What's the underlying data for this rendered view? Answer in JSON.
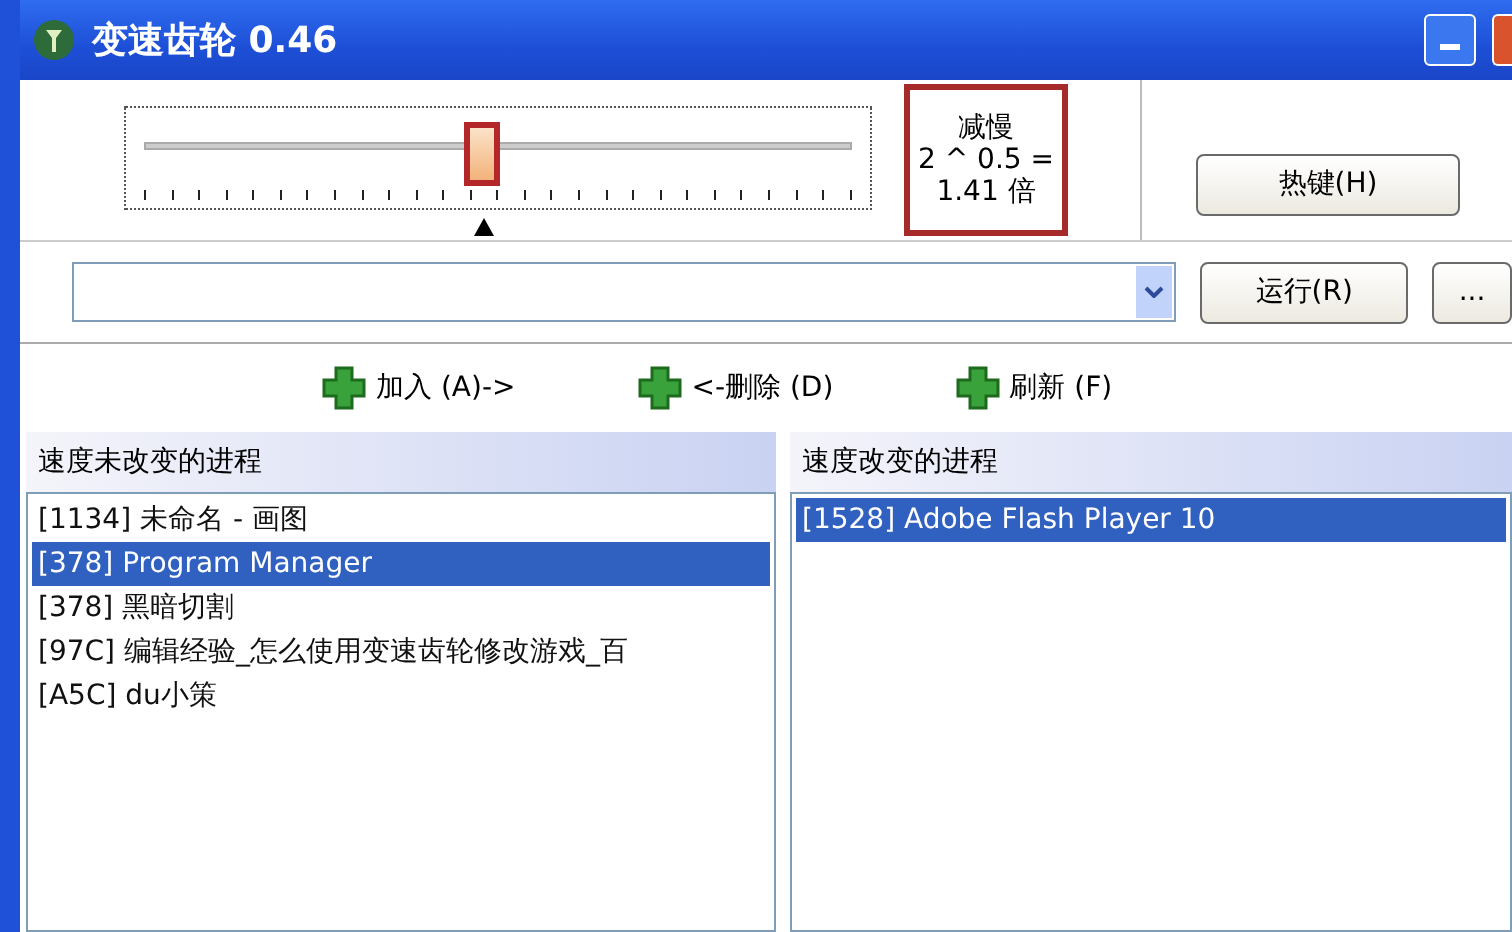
{
  "window": {
    "title": "变速齿轮 0.46"
  },
  "speed": {
    "level": 0.47,
    "readout": [
      "减慢",
      "2 ^ 0.5 =",
      "1.41 倍"
    ]
  },
  "hotkey_button": "热键(H)",
  "run_button": "运行(R)",
  "more_button": "...",
  "actions": [
    {
      "label": "加入 (A)->"
    },
    {
      "label": "<-删除 (D)"
    },
    {
      "label": "刷新 (F)"
    }
  ],
  "panels": [
    {
      "header": "速度未改变的进程",
      "items": [
        {
          "text": "[1134]  未命名 - 画图",
          "selected": false
        },
        {
          "text": "[378]  Program Manager",
          "selected": true
        },
        {
          "text": "[378]  黑暗切割",
          "selected": false
        },
        {
          "text": "[97C]  编辑经验_怎么使用变速齿轮修改游戏_百",
          "selected": false
        },
        {
          "text": "[A5C]  du小策",
          "selected": false
        }
      ]
    },
    {
      "header": "速度改变的进程",
      "items": [
        {
          "text": "[1528]  Adobe Flash Player 10",
          "selected": true
        }
      ]
    }
  ]
}
